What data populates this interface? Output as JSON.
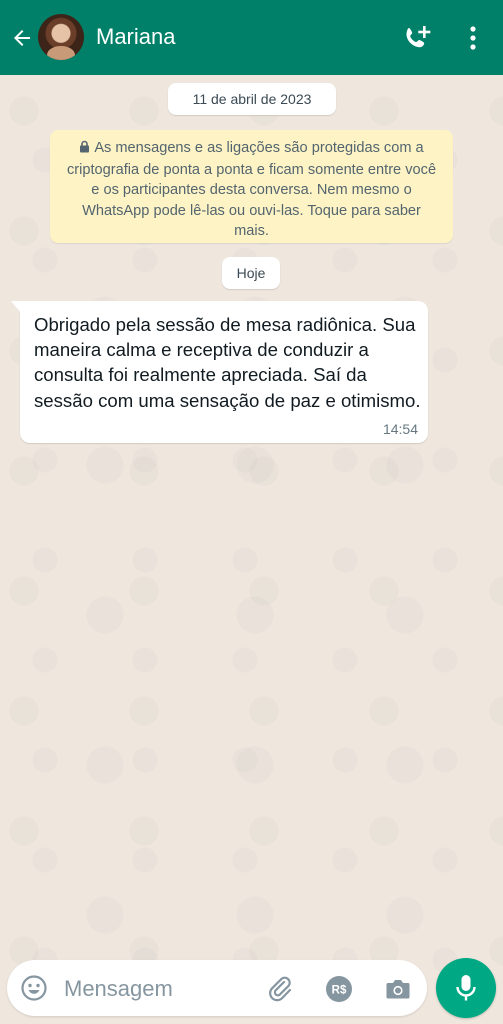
{
  "header": {
    "contact_name": "Mariana",
    "back_icon": "arrow-left-icon",
    "call_icon": "add-call-icon",
    "menu_icon": "more-vertical-icon",
    "background_color": "#008069"
  },
  "chat": {
    "date_chip": "11 de abril de 2023",
    "encryption_notice": "As mensagens e as ligações são protegidas com a criptografia de ponta a ponta e ficam somente entre você e os participantes desta conversa. Nem mesmo o WhatsApp pode lê-las ou ouvi-las. Toque para saber mais.",
    "today_chip": "Hoje",
    "messages": [
      {
        "text": "Obrigado pela sessão de mesa radiônica. Sua maneira calma e receptiva de conduzir a consulta foi realmente apreciada. Saí da sessão com uma sensação de paz e otimismo.",
        "time": "14:54",
        "direction": "incoming"
      }
    ]
  },
  "composer": {
    "placeholder": "Mensagem",
    "icons": [
      "emoji-icon",
      "paperclip-icon",
      "payment-icon",
      "camera-icon",
      "microphone-icon"
    ],
    "payment_label": "R$",
    "accent_color": "#00a884"
  }
}
